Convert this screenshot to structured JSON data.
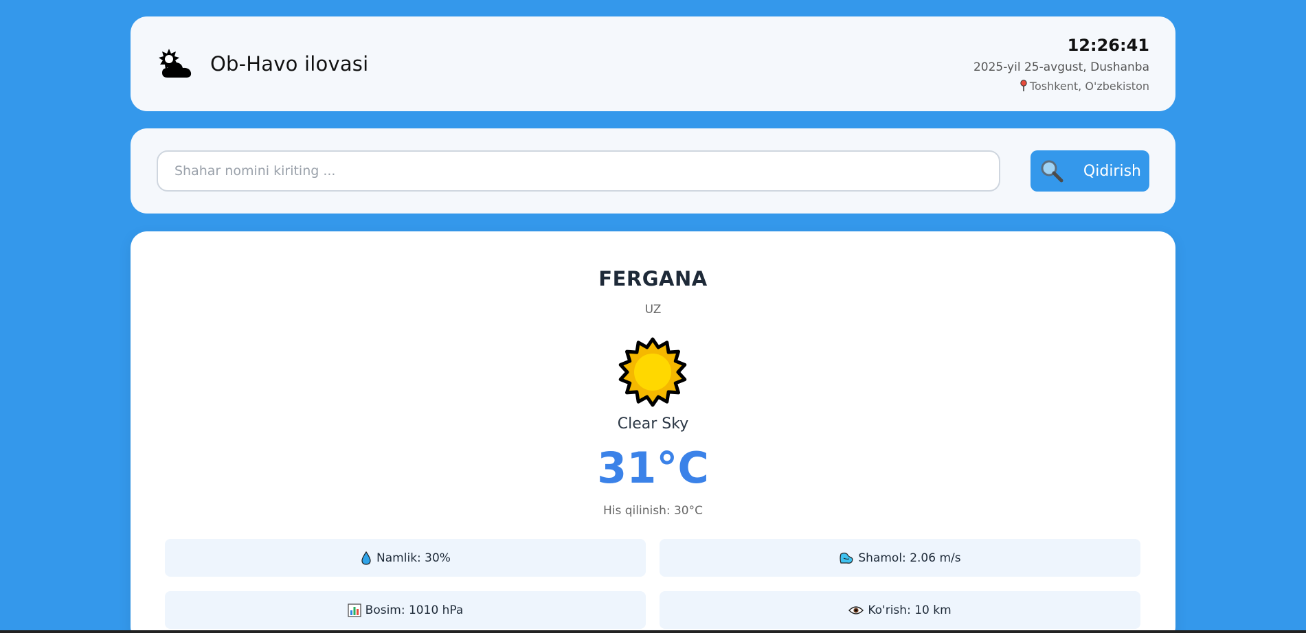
{
  "header": {
    "app_title": "Ob-Havo ilovasi",
    "app_icon": "sun-behind-cloud-icon",
    "clock": "12:26:41",
    "date": "2025-yil 25-avgust, Dushanba",
    "location": "Toshkent, O'zbekiston",
    "location_icon": "pin-icon"
  },
  "search": {
    "value": "",
    "placeholder": "Shahar nomini kiriting ...",
    "button_label": "Qidirish",
    "button_icon": "magnifier-icon"
  },
  "weather": {
    "city": "FERGANA",
    "country": "UZ",
    "condition_icon": "sun-icon",
    "description": "Clear Sky",
    "temperature": "31°C",
    "feels_like": "His qilinish: 30°C",
    "stats": {
      "humidity": {
        "icon": "droplet-icon",
        "label": "Namlik: 30%"
      },
      "wind": {
        "icon": "wind-icon",
        "label": "Shamol: 2.06 m/s"
      },
      "pressure": {
        "icon": "bar-chart-icon",
        "label": "Bosim: 1010 hPa"
      },
      "visibility": {
        "icon": "eye-icon",
        "label": "Ko'rish: 10 km"
      }
    }
  },
  "colors": {
    "background": "#3498eb",
    "accent_button": "#3498eb",
    "temperature": "#3b82e8",
    "card": "#f5f8fc",
    "stat_tile": "#eef5fd"
  }
}
